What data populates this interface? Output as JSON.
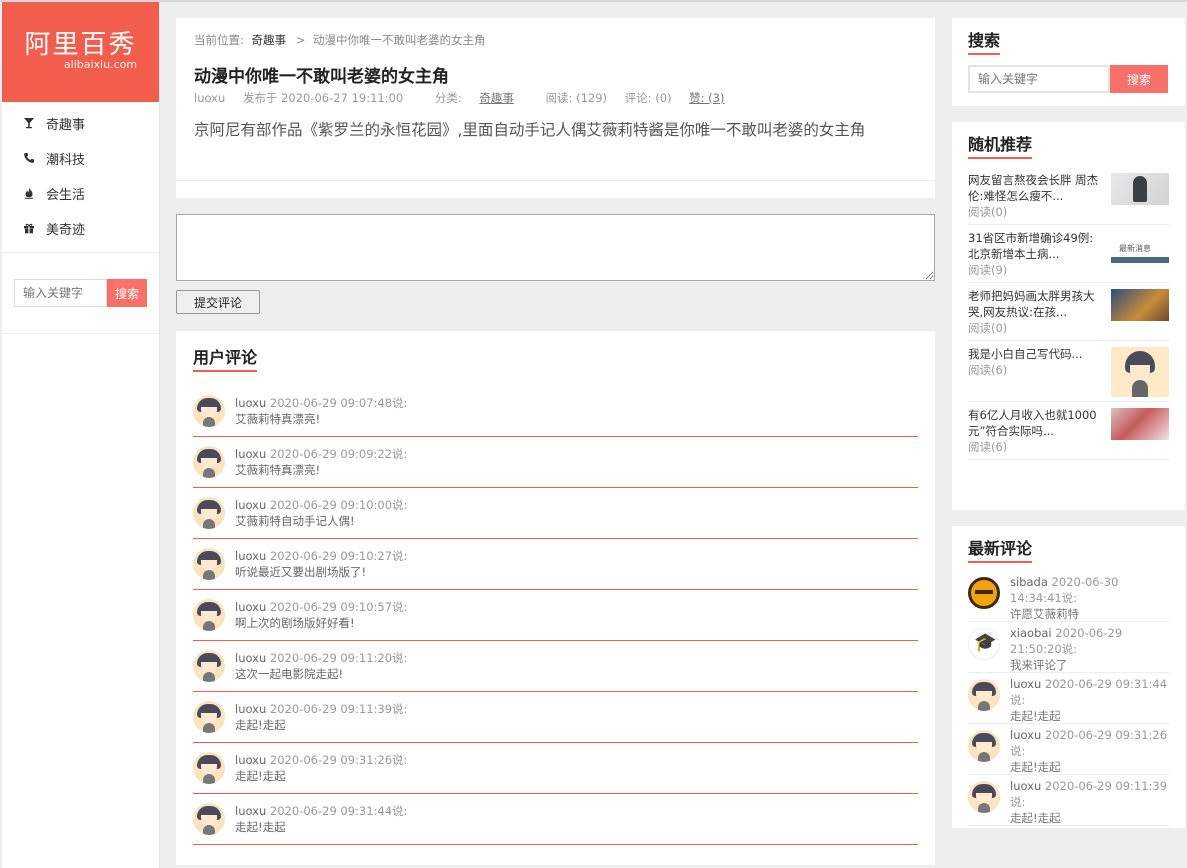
{
  "sidebar": {
    "logo_cn": "阿里百秀",
    "logo_en": "alibaixiu.com",
    "nav": [
      {
        "label": "奇趣事",
        "icon": "glass-icon"
      },
      {
        "label": "潮科技",
        "icon": "phone-icon"
      },
      {
        "label": "会生活",
        "icon": "fire-icon"
      },
      {
        "label": "美奇迹",
        "icon": "gift-icon"
      }
    ],
    "search_placeholder": "输入关键字",
    "search_button": "搜索"
  },
  "article": {
    "breadcrumb_prefix": "当前位置:",
    "breadcrumb_category": "奇趣事",
    "breadcrumb_sep": ">",
    "breadcrumb_current": "动漫中你唯一不敢叫老婆的女主角",
    "title": "动漫中你唯一不敢叫老婆的女主角",
    "author": "luoxu",
    "published": "发布于 2020-06-27 19:11:00",
    "category_label": "分类:",
    "category": "奇趣事",
    "reads": "阅读: (129)",
    "comments": "评论: (0)",
    "likes": "赞: (3)",
    "excerpt": "京阿尼有部作品《紫罗兰的永恒花园》,里面自动手记人偶艾薇莉特酱是你唯一不敢叫老婆的女主角"
  },
  "comment_form": {
    "submit_label": "提交评论"
  },
  "comments": {
    "title": "用户评论",
    "items": [
      {
        "user": "luoxu",
        "time": "2020-06-29 09:07:48说:",
        "text": "艾薇莉特真漂亮!"
      },
      {
        "user": "luoxu",
        "time": "2020-06-29 09:09:22说:",
        "text": "艾薇莉特真漂亮!"
      },
      {
        "user": "luoxu",
        "time": "2020-06-29 09:10:00说:",
        "text": "艾薇莉特自动手记人偶!"
      },
      {
        "user": "luoxu",
        "time": "2020-06-29 09:10:27说:",
        "text": "听说最近又要出剧场版了!"
      },
      {
        "user": "luoxu",
        "time": "2020-06-29 09:10:57说:",
        "text": "啊上次的剧场版好好看!"
      },
      {
        "user": "luoxu",
        "time": "2020-06-29 09:11:20说:",
        "text": "这次一起电影院走起!"
      },
      {
        "user": "luoxu",
        "time": "2020-06-29 09:11:39说:",
        "text": "走起!走起"
      },
      {
        "user": "luoxu",
        "time": "2020-06-29 09:31:26说:",
        "text": "走起!走起"
      },
      {
        "user": "luoxu",
        "time": "2020-06-29 09:31:44说:",
        "text": "走起!走起"
      }
    ]
  },
  "right_search": {
    "title": "搜索",
    "placeholder": "输入关键字",
    "button": "搜索"
  },
  "random": {
    "title": "随机推荐",
    "items": [
      {
        "title": "网友留言熬夜会长胖 周杰伦:难怪怎么瘦不...",
        "reads": "阅读(0)"
      },
      {
        "title": "31省区市新增确诊49例:北京新增本土病...",
        "reads": "阅读(9)"
      },
      {
        "title": "老师把妈妈画太胖男孩大哭,网友热议:在孩...",
        "reads": "阅读(0)"
      },
      {
        "title": "我是小白自己写代码...",
        "reads": "阅读(6)"
      },
      {
        "title": "有6亿人月收入也就1000元”符合实际吗...",
        "reads": "阅读(6)"
      }
    ]
  },
  "latest": {
    "title": "最新评论",
    "items": [
      {
        "user": "sibada",
        "time": "2020-06-30 14:34:41说:",
        "text": "许愿艾薇莉特"
      },
      {
        "user": "xiaobai",
        "time": "2020-06-29 21:50:20说:",
        "text": "我来评论了"
      },
      {
        "user": "luoxu",
        "time": "2020-06-29 09:31:44说:",
        "text": "走起!走起"
      },
      {
        "user": "luoxu",
        "time": "2020-06-29 09:31:26说:",
        "text": "走起!走起"
      },
      {
        "user": "luoxu",
        "time": "2020-06-29 09:11:39说:",
        "text": "走起!走起"
      }
    ]
  },
  "colors": {
    "brand": "#f25d4d",
    "button": "#f7716a"
  }
}
